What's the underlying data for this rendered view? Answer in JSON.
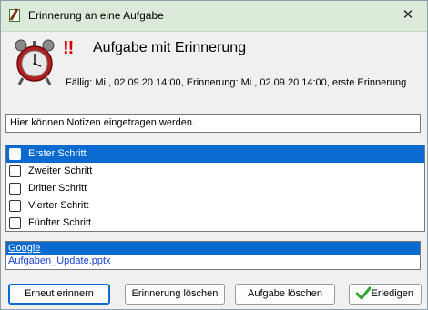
{
  "window": {
    "title": "Erinnerung an eine Aufgabe",
    "close_glyph": "✕"
  },
  "header": {
    "priority_marks": "!!",
    "task_title": "Aufgabe mit Erinnerung",
    "due_line": "Fällig: Mi., 02.09.20 14:00, Erinnerung: Mi., 02.09.20 14:00, erste Erinnerung"
  },
  "notes": {
    "text": "Hier können Notizen eingetragen werden."
  },
  "steps": [
    {
      "label": "Erster Schritt",
      "checked": false,
      "selected": true
    },
    {
      "label": "Zweiter Schritt",
      "checked": false,
      "selected": false
    },
    {
      "label": "Dritter Schritt",
      "checked": false,
      "selected": false
    },
    {
      "label": "Vierter Schritt",
      "checked": false,
      "selected": false
    },
    {
      "label": "Fünfter Schritt",
      "checked": false,
      "selected": false
    }
  ],
  "attachments": [
    {
      "label": "Google",
      "selected": true
    },
    {
      "label": "Aufgaben_Update.pptx",
      "selected": false
    }
  ],
  "buttons": {
    "remind_again": "Erneut erinnern",
    "delete_reminder": "Erinnerung löschen",
    "delete_task": "Aufgabe löschen",
    "done": "Erledigen"
  },
  "colors": {
    "selection": "#0a6ad0",
    "title_bar": "#dcebd9",
    "priority": "#d40000",
    "check": "#2fa52f"
  }
}
